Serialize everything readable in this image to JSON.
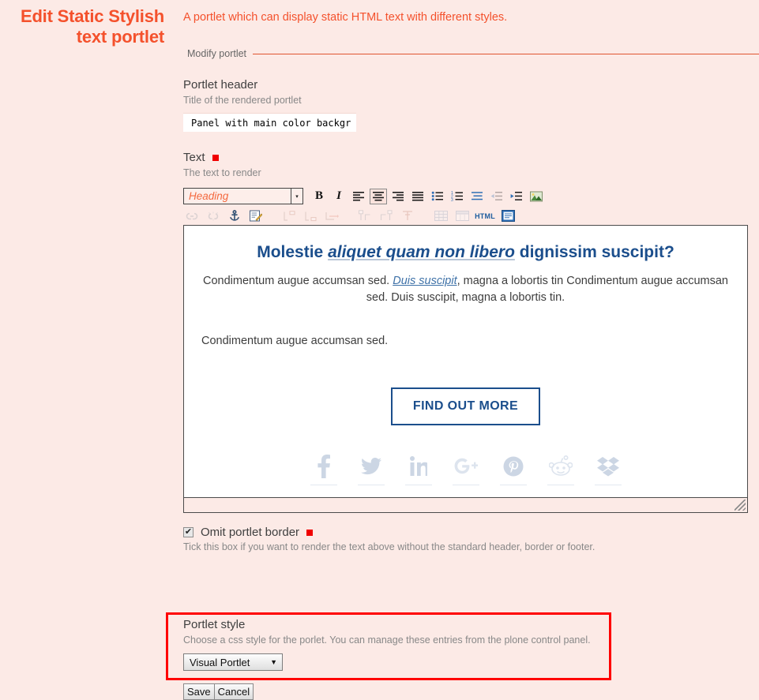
{
  "page": {
    "title": "Edit Static Stylish text portlet",
    "lead": "A portlet which can display static HTML text with different styles.",
    "legend": "Modify portlet"
  },
  "fields": {
    "header": {
      "label": "Portlet header",
      "help": "Title of the rendered portlet",
      "value": "Panel with main color background",
      "placeholder": ""
    },
    "text": {
      "label": "Text",
      "help": "The text to render",
      "required_marker": "■"
    },
    "omit_border": {
      "label": "Omit portlet border",
      "help": "Tick this box if you want to render the text above without the standard header, border or footer.",
      "checked": true,
      "check_glyph": "✔"
    },
    "portlet_style": {
      "label": "Portlet style",
      "help": "Choose a css style for the porlet. You can manage these entries from the plone control panel.",
      "value": "Visual Portlet",
      "arrow": "▼"
    }
  },
  "editor": {
    "style_select": {
      "value": "Heading",
      "arrow": "▾"
    },
    "toolbar_row1": [
      {
        "name": "bold-icon",
        "label": "B"
      },
      {
        "name": "italic-icon",
        "label": "I"
      },
      {
        "name": "align-left-icon",
        "label": ""
      },
      {
        "name": "align-center-icon",
        "label": ""
      },
      {
        "name": "align-right-icon",
        "label": ""
      },
      {
        "name": "align-justify-icon",
        "label": ""
      },
      {
        "name": "bullet-list-icon",
        "label": ""
      },
      {
        "name": "numbered-list-icon",
        "label": ""
      },
      {
        "name": "definition-list-icon",
        "label": ""
      },
      {
        "name": "outdent-icon",
        "label": ""
      },
      {
        "name": "indent-icon",
        "label": ""
      },
      {
        "name": "image-icon",
        "label": ""
      }
    ],
    "toolbar_row2": [
      {
        "name": "link-icon",
        "label": ""
      },
      {
        "name": "unlink-icon",
        "label": ""
      },
      {
        "name": "anchor-icon",
        "label": ""
      },
      {
        "name": "edit-source-icon",
        "label": ""
      },
      {
        "name": "insert-definition-icon",
        "label": ""
      },
      {
        "name": "insert-term-icon",
        "label": ""
      },
      {
        "name": "insert-row-icon",
        "label": ""
      },
      {
        "name": "column-before-icon",
        "label": ""
      },
      {
        "name": "column-after-icon",
        "label": ""
      },
      {
        "name": "delete-column-icon",
        "label": ""
      },
      {
        "name": "table-grid-icon",
        "label": ""
      },
      {
        "name": "table-props-icon",
        "label": ""
      },
      {
        "name": "html-source-icon",
        "label": "HTML"
      },
      {
        "name": "fullscreen-icon",
        "label": ""
      }
    ],
    "content": {
      "heading_pre": "Molestie ",
      "heading_link": "aliquet quam non libero",
      "heading_post": " dignissim suscipit?",
      "para1_pre": "Condimentum augue accumsan sed. ",
      "para1_link": "Duis suscipit",
      "para1_post": ", magna a lobortis tin Condimentum augue accumsan sed. Duis suscipit, magna a lobortis tin.",
      "para2": "Condimentum augue accumsan sed.",
      "cta": "FIND OUT MORE",
      "social": [
        {
          "name": "facebook-icon",
          "glyph": "f"
        },
        {
          "name": "twitter-icon",
          "glyph": "t"
        },
        {
          "name": "linkedin-icon",
          "glyph": "in"
        },
        {
          "name": "googleplus-icon",
          "glyph": "g+"
        },
        {
          "name": "pinterest-icon",
          "glyph": "p"
        },
        {
          "name": "reddit-icon",
          "glyph": "r"
        },
        {
          "name": "dropbox-icon",
          "glyph": "d"
        }
      ]
    }
  },
  "actions": {
    "save": "Save",
    "cancel": "Cancel"
  },
  "colors": {
    "background": "#fceae6",
    "accent": "#f4512c",
    "editor_blue": "#1b4e8c",
    "required": "#f00000",
    "highlight": "#ff0000"
  }
}
